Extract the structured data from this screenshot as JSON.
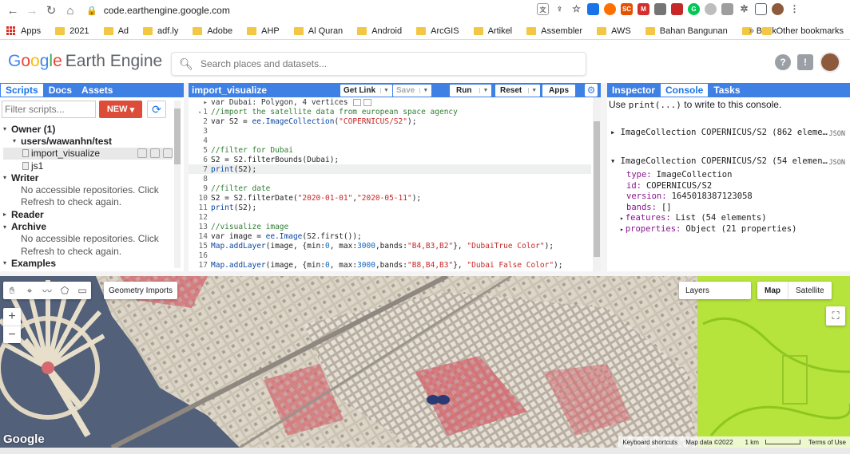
{
  "browser": {
    "url": "code.earthengine.google.com",
    "bookmarks": [
      "2021",
      "Ad",
      "adf.ly",
      "Adobe",
      "AHP",
      "Al Quran",
      "Android",
      "ArcGIS",
      "Artikel",
      "Assembler",
      "AWS",
      "Bahan Bangunan",
      "Bank"
    ],
    "apps_label": "Apps",
    "more": "»",
    "other_bookmarks": "Other bookmarks"
  },
  "header": {
    "logo_google": [
      "G",
      "o",
      "o",
      "g",
      "l",
      "e"
    ],
    "logo_product": "Earth Engine",
    "search_placeholder": "Search places and datasets...",
    "help_icon": "?",
    "feedback_icon": "!"
  },
  "left_panel": {
    "tabs": [
      "Scripts",
      "Docs",
      "Assets"
    ],
    "filter_placeholder": "Filter scripts...",
    "new_label": "NEW",
    "tree": [
      {
        "label": "Owner (1)",
        "level": 0,
        "bold": true,
        "arrow": "▾"
      },
      {
        "label": "users/wawanhn/test",
        "level": 1,
        "bold": true,
        "arrow": "▾"
      },
      {
        "label": "import_visualize",
        "level": 2,
        "file": true,
        "selected": true
      },
      {
        "label": "js1",
        "level": 2,
        "file": true
      },
      {
        "label": "Writer",
        "level": 0,
        "bold": true,
        "arrow": "▾"
      },
      {
        "label": "No accessible repositories. Click",
        "level": 1,
        "muted": true
      },
      {
        "label": "Refresh to check again.",
        "level": 1,
        "muted": true
      },
      {
        "label": "Reader",
        "level": 0,
        "bold": true,
        "arrow": "▸"
      },
      {
        "label": "Archive",
        "level": 0,
        "bold": true,
        "arrow": "▾"
      },
      {
        "label": "No accessible repositories. Click",
        "level": 1,
        "muted": true
      },
      {
        "label": "Refresh to check again.",
        "level": 1,
        "muted": true
      },
      {
        "label": "Examples",
        "level": 0,
        "bold": true,
        "arrow": "▾"
      }
    ]
  },
  "editor": {
    "title": "import_visualize",
    "buttons": {
      "get_link": "Get Link",
      "save": "Save",
      "run": "Run",
      "reset": "Reset",
      "apps": "Apps"
    },
    "import_header": "var Dubai: Polygon, 4 vertices",
    "lines": [
      {
        "n": "1",
        "fold": true,
        "parts": [
          {
            "t": "//import the satellite data from european space agency",
            "c": "cm"
          }
        ]
      },
      {
        "n": "2",
        "parts": [
          {
            "t": "var S2 = ",
            "c": "kw"
          },
          {
            "t": "ee.ImageCollection",
            "c": "fn"
          },
          {
            "t": "(",
            "c": "kw"
          },
          {
            "t": "\"COPERNICUS/S2\"",
            "c": "str"
          },
          {
            "t": ");",
            "c": "kw"
          }
        ]
      },
      {
        "n": "3",
        "parts": []
      },
      {
        "n": "4",
        "parts": []
      },
      {
        "n": "5",
        "parts": [
          {
            "t": "//filter for Dubai",
            "c": "cm"
          }
        ]
      },
      {
        "n": "6",
        "parts": [
          {
            "t": "S2 = S2.filterBounds(Dubai);",
            "c": "kw"
          }
        ]
      },
      {
        "n": "7",
        "hl": true,
        "parts": [
          {
            "t": "print",
            "c": "fn"
          },
          {
            "t": "(S2);",
            "c": "kw"
          }
        ]
      },
      {
        "n": "8",
        "parts": []
      },
      {
        "n": "9",
        "parts": [
          {
            "t": "//filter date",
            "c": "cm"
          }
        ]
      },
      {
        "n": "10",
        "parts": [
          {
            "t": "S2 = S2.filterDate(",
            "c": "kw"
          },
          {
            "t": "\"2020-01-01\"",
            "c": "str"
          },
          {
            "t": ",",
            "c": "kw"
          },
          {
            "t": "\"2020-05-11\"",
            "c": "str"
          },
          {
            "t": ");",
            "c": "kw"
          }
        ]
      },
      {
        "n": "11",
        "parts": [
          {
            "t": "print",
            "c": "fn"
          },
          {
            "t": "(S2);",
            "c": "kw"
          }
        ]
      },
      {
        "n": "12",
        "parts": []
      },
      {
        "n": "13",
        "parts": [
          {
            "t": "//visualize image",
            "c": "cm"
          }
        ]
      },
      {
        "n": "14",
        "parts": [
          {
            "t": "var image = ",
            "c": "kw"
          },
          {
            "t": "ee.Image",
            "c": "fn"
          },
          {
            "t": "(S2.first());",
            "c": "kw"
          }
        ]
      },
      {
        "n": "15",
        "parts": [
          {
            "t": "Map.addLayer",
            "c": "fn"
          },
          {
            "t": "(image, {min:",
            "c": "kw"
          },
          {
            "t": "0",
            "c": "num"
          },
          {
            "t": ", max:",
            "c": "kw"
          },
          {
            "t": "3000",
            "c": "num"
          },
          {
            "t": ",bands:",
            "c": "kw"
          },
          {
            "t": "\"B4,B3,B2\"",
            "c": "str"
          },
          {
            "t": "}, ",
            "c": "kw"
          },
          {
            "t": "\"DubaiTrue Color\"",
            "c": "str"
          },
          {
            "t": ");",
            "c": "kw"
          }
        ]
      },
      {
        "n": "16",
        "parts": []
      },
      {
        "n": "17",
        "parts": [
          {
            "t": "Map.addLayer",
            "c": "fn"
          },
          {
            "t": "(image, {min:",
            "c": "kw"
          },
          {
            "t": "0",
            "c": "num"
          },
          {
            "t": ", max:",
            "c": "kw"
          },
          {
            "t": "3000",
            "c": "num"
          },
          {
            "t": ",bands:",
            "c": "kw"
          },
          {
            "t": "\"B8,B4,B3\"",
            "c": "str"
          },
          {
            "t": "}, ",
            "c": "kw"
          },
          {
            "t": "\"Dubai False Color\"",
            "c": "str"
          },
          {
            "t": ");",
            "c": "kw"
          }
        ]
      }
    ]
  },
  "right_panel": {
    "tabs": [
      "Inspector",
      "Console",
      "Tasks"
    ],
    "hint_pre": "Use ",
    "hint_code": "print(...)",
    "hint_post": " to write to this console.",
    "entries": [
      {
        "label": "ImageCollection COPERNICUS/S2 (862 eleme…",
        "arrow": "▸",
        "tag": "JSON"
      },
      {
        "label": "ImageCollection COPERNICUS/S2 (54 elemen…",
        "arrow": "▾",
        "tag": "JSON"
      }
    ],
    "props": [
      {
        "k": "type:",
        "v": "ImageCollection"
      },
      {
        "k": "id:",
        "v": "COPERNICUS/S2"
      },
      {
        "k": "version:",
        "v": "1645018387123058"
      },
      {
        "k": "bands:",
        "v": "[]"
      },
      {
        "k": "features:",
        "v": "List (54 elements)",
        "arrow": "▸"
      },
      {
        "k": "properties:",
        "v": "Object (21 properties)",
        "arrow": "▸"
      }
    ]
  },
  "map": {
    "geometry_imports": "Geometry Imports",
    "layers": "Layers",
    "map_btn": "Map",
    "satellite_btn": "Satellite",
    "zoom_in": "+",
    "zoom_out": "−",
    "watermark": "Google",
    "attribution": {
      "shortcuts": "Keyboard shortcuts",
      "data": "Map data ©2022",
      "scale": "1 km",
      "terms": "Terms of Use"
    }
  }
}
